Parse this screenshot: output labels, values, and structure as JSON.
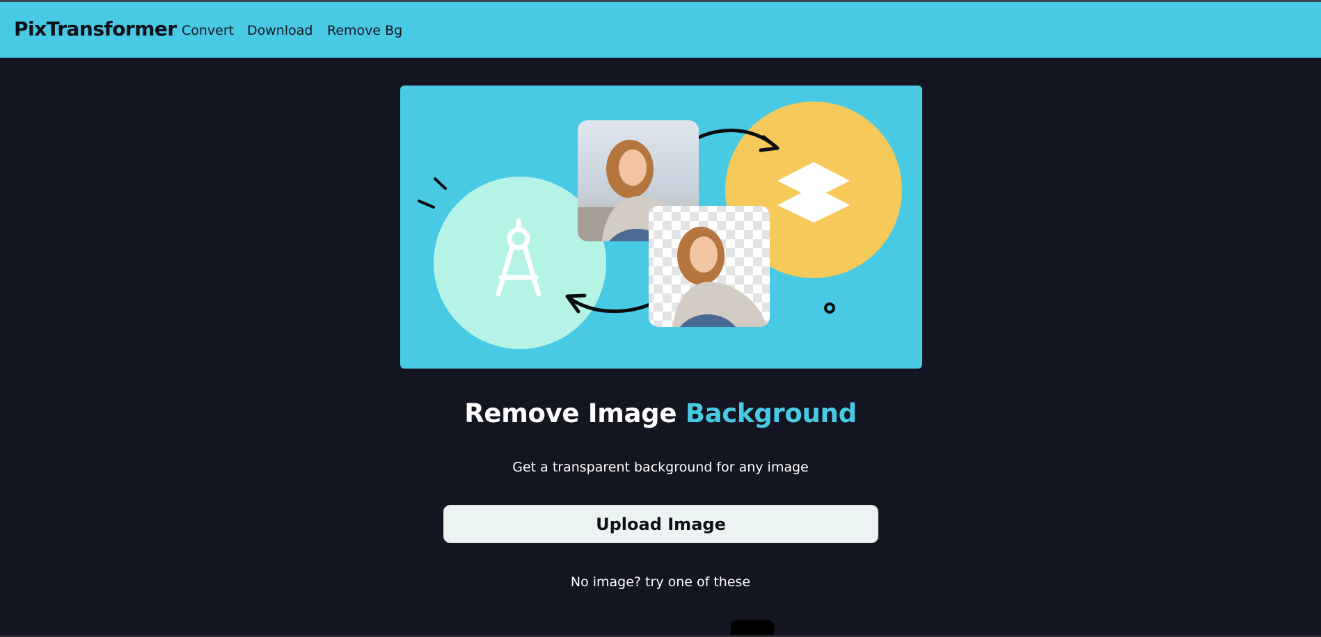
{
  "navbar": {
    "brand": "PixTransformer",
    "links": [
      "Convert",
      "Download",
      "Remove Bg"
    ],
    "background_color": "#48c9e4"
  },
  "hero": {
    "background_color": "#48c9e4",
    "icons": [
      "compass-icon",
      "layers-icon",
      "arrow-icon"
    ]
  },
  "main": {
    "headline_part1": "Remove Image ",
    "headline_accent": "Background",
    "accent_color": "#48c9e4",
    "subtitle": "Get a transparent background for any image",
    "upload_label": "Upload Image",
    "no_image_text": "No image? try one of these"
  },
  "colors": {
    "page_background": "#131520",
    "button_background": "#ebf4f3",
    "mint_circle": "#b5f3e6",
    "yellow_circle": "#f5ca5b"
  }
}
